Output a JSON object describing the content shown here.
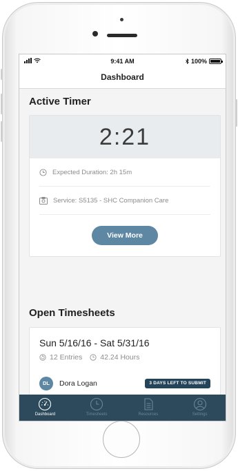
{
  "status_bar": {
    "time": "9:41 AM",
    "battery": "100%",
    "battery_level": 1.0
  },
  "nav": {
    "title": "Dashboard"
  },
  "active_timer": {
    "heading": "Active Timer",
    "elapsed": "2:21",
    "expected_duration": "Expected Duration: 2h 15m",
    "service": "Service: S5135 - SHC Companion Care",
    "view_more_label": "View More"
  },
  "open_timesheets": {
    "heading": "Open Timesheets",
    "items": [
      {
        "date_range": "Sun 5/16/16 - Sat 5/31/16",
        "entries": "12 Entries",
        "hours": "42.24 Hours",
        "initials": "DL",
        "name": "Dora Logan",
        "badge": "3 DAYS LEFT TO SUBMIT"
      }
    ]
  },
  "tabs": [
    {
      "label": "Dashboard",
      "icon": "speedometer-icon",
      "active": true
    },
    {
      "label": "Timesheets",
      "icon": "clock-icon",
      "active": false
    },
    {
      "label": "Resources",
      "icon": "document-icon",
      "active": false
    },
    {
      "label": "Settings",
      "icon": "person-icon",
      "active": false
    }
  ],
  "colors": {
    "accent": "#5d87a3",
    "tabbar": "#2c4a5c",
    "badge": "#244559",
    "timer_bg": "#e8ecef"
  }
}
